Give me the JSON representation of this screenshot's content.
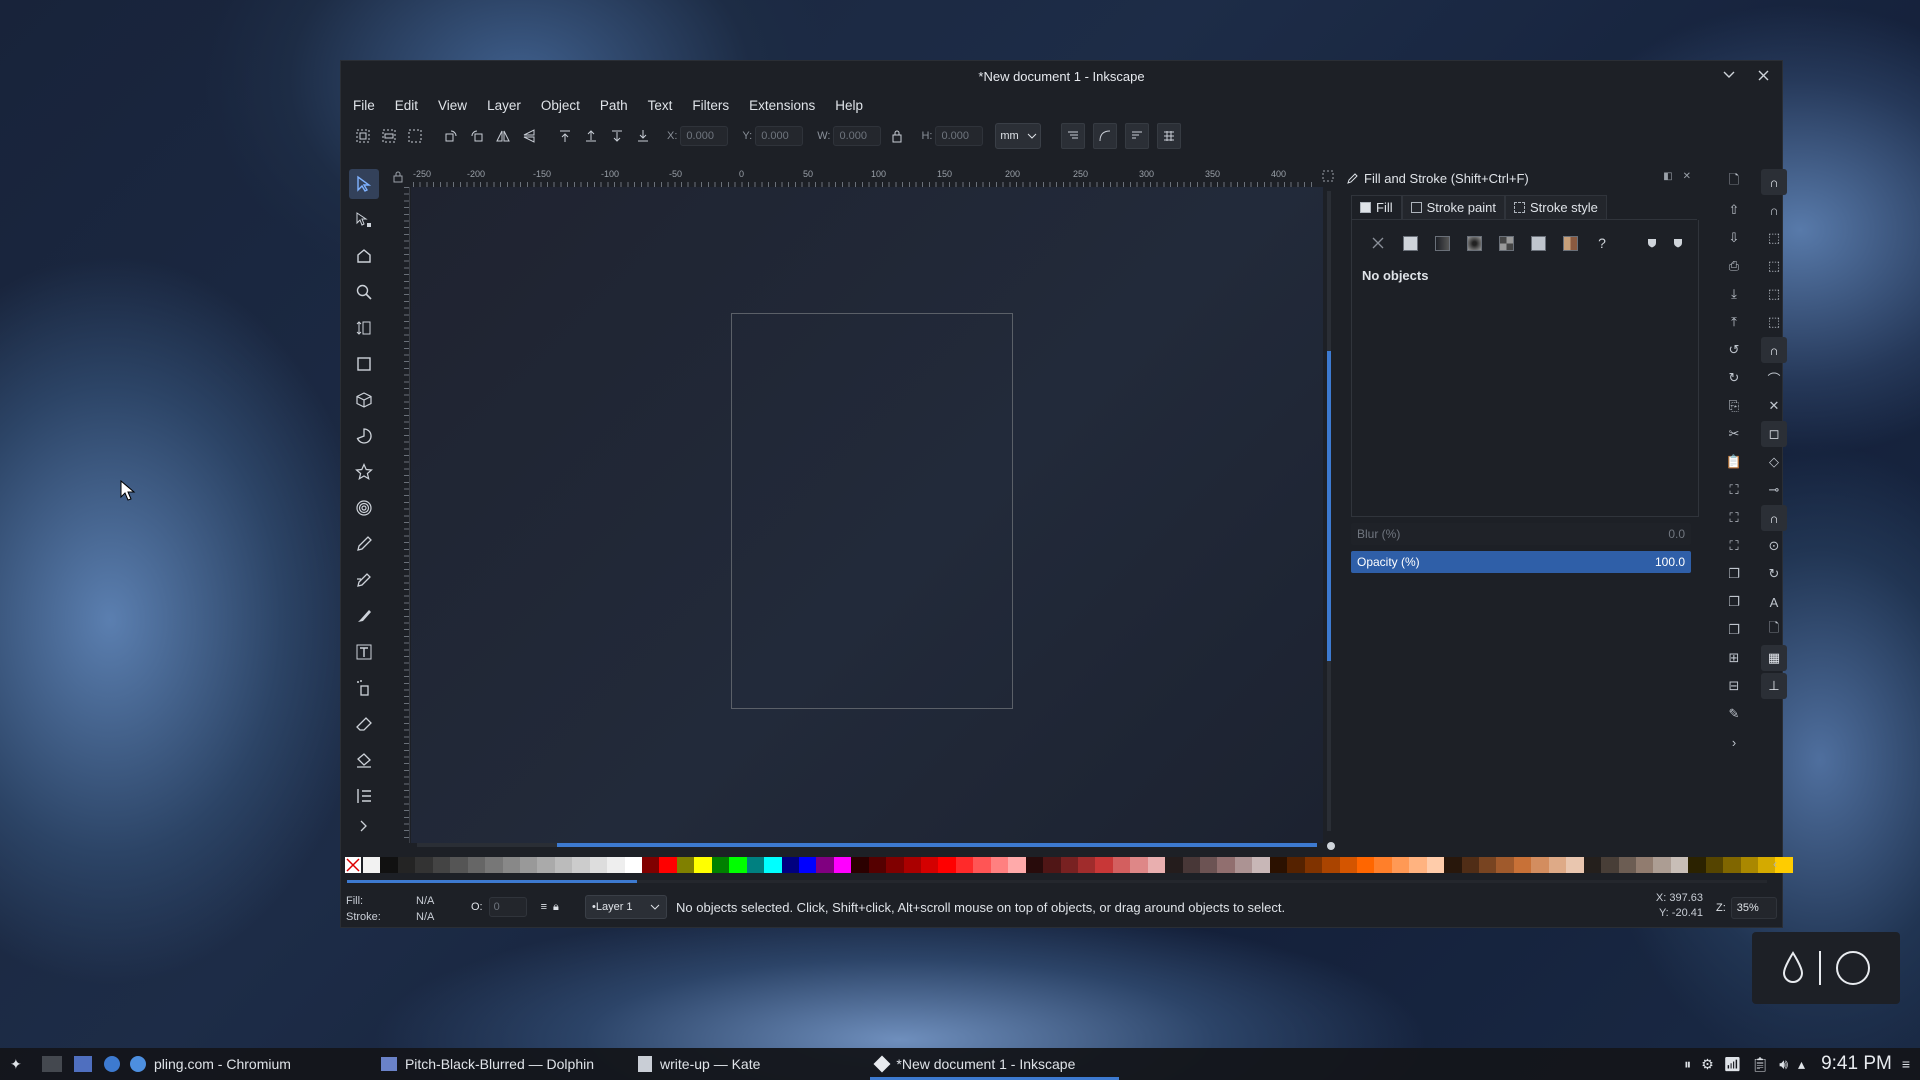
{
  "window": {
    "title": "*New document 1 - Inkscape",
    "controls": {
      "minimize_icon": "chevron-down-icon",
      "close_icon": "close-icon"
    }
  },
  "menu": [
    "File",
    "Edit",
    "View",
    "Layer",
    "Object",
    "Path",
    "Text",
    "Filters",
    "Extensions",
    "Help"
  ],
  "toolbar": {
    "x_label": "X:",
    "x_value": "0.000",
    "y_label": "Y:",
    "y_value": "0.000",
    "w_label": "W:",
    "w_value": "0.000",
    "h_label": "H:",
    "h_value": "0.000",
    "unit": "mm"
  },
  "ruler": {
    "h_labels": [
      "-250",
      "-200",
      "-150",
      "-100",
      "-50",
      "0",
      "50",
      "100",
      "150",
      "200",
      "250",
      "300",
      "350",
      "400"
    ]
  },
  "tools": [
    "selector",
    "node",
    "tweak",
    "zoom",
    "measure-pages",
    "rectangle",
    "box-3d",
    "ellipse",
    "star",
    "spiral",
    "pencil",
    "pen",
    "calligraphy",
    "text",
    "spray",
    "eraser",
    "paint-bucket",
    "gradient"
  ],
  "panel": {
    "title": "Fill and Stroke (Shift+Ctrl+F)",
    "tabs": [
      {
        "label": "Fill",
        "active": true
      },
      {
        "label": "Stroke paint",
        "active": false
      },
      {
        "label": "Stroke style",
        "active": false
      }
    ],
    "paint_types": [
      "no-paint",
      "flat-color",
      "linear-gradient",
      "radial-gradient",
      "mesh-gradient",
      "pattern",
      "swatch",
      "unset"
    ],
    "empty_message": "No objects",
    "blur_label": "Blur (%)",
    "blur_value": "0.0",
    "opacity_label": "Opacity (%)",
    "opacity_value": "100.0"
  },
  "palette": [
    "#f2f2f2",
    "#111111",
    "#242424",
    "#333333",
    "#444444",
    "#555555",
    "#666666",
    "#777777",
    "#888888",
    "#999999",
    "#aaaaaa",
    "#bbbbbb",
    "#cccccc",
    "#dddddd",
    "#eeeeee",
    "#ffffff",
    "#800000",
    "#ff0000",
    "#808000",
    "#ffff00",
    "#008000",
    "#00ff00",
    "#008080",
    "#00ffff",
    "#000080",
    "#0000ff",
    "#800080",
    "#ff00ff",
    "#2b0000",
    "#550000",
    "#800000",
    "#aa0000",
    "#d40000",
    "#ff0000",
    "#ff2a2a",
    "#ff5555",
    "#ff8080",
    "#ffaaaa",
    "#280b0b",
    "#501616",
    "#782121",
    "#a02c2c",
    "#c83737",
    "#d35f5f",
    "#de8787",
    "#e9afaf",
    "#241c1c",
    "#483737",
    "#6c5353",
    "#916f6f",
    "#ac9393",
    "#c8b7b7",
    "#2b1100",
    "#552200",
    "#803300",
    "#aa4400",
    "#d45500",
    "#ff6600",
    "#ff7f2a",
    "#ff9955",
    "#ffb380",
    "#ffccaa",
    "#28170b",
    "#502d16",
    "#784421",
    "#a05a2c",
    "#c87137",
    "#d38d5f",
    "#deaa87",
    "#e9c6af",
    "#241f1c",
    "#483e37",
    "#6c5d53",
    "#917c6f",
    "#ac9d93",
    "#c8beb7",
    "#2b2200",
    "#554400",
    "#806600",
    "#aa8800",
    "#d4aa00",
    "#ffcc00"
  ],
  "status": {
    "fill_label": "Fill:",
    "fill_value": "N/A",
    "stroke_label": "Stroke:",
    "stroke_value": "N/A",
    "opacity_label": "O:",
    "opacity_value": "0",
    "layer": "•Layer 1",
    "message": "No objects selected. Click, Shift+click, Alt+scroll mouse on top of objects, or drag around objects to select.",
    "x_coord": "X: 397.63",
    "y_coord": "Y: -20.41",
    "zoom_label": "Z:",
    "zoom_value": "35%"
  },
  "taskbar": {
    "tasks": [
      {
        "label": "pling.com - Chromium",
        "icon": "chromium-icon",
        "active": false
      },
      {
        "label": "Pitch-Black-Blurred — Dolphin",
        "icon": "dolphin-icon",
        "active": false
      },
      {
        "label": "write-up — Kate",
        "icon": "kate-icon",
        "active": false
      },
      {
        "label": "*New document 1 - Inkscape",
        "icon": "inkscape-icon",
        "active": true
      }
    ],
    "clock": "9:41 PM"
  }
}
